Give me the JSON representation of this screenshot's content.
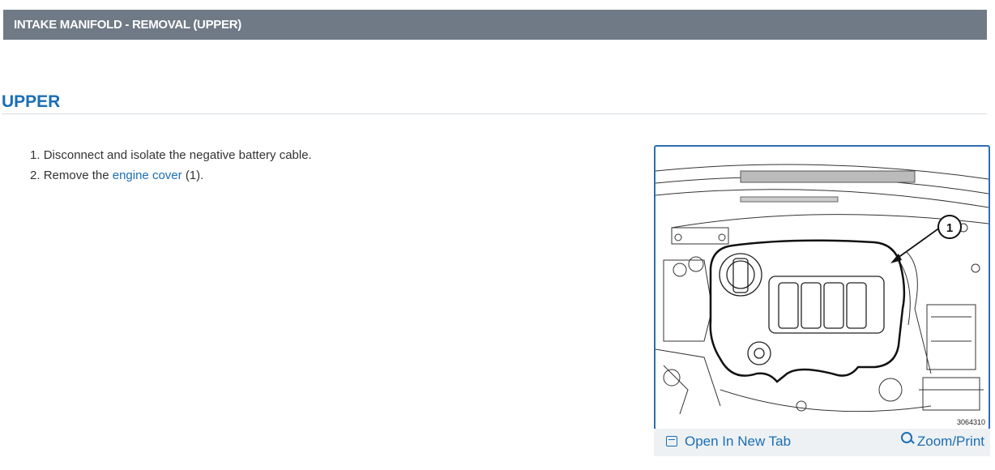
{
  "header": {
    "title": "INTAKE MANIFOLD - REMOVAL (UPPER)"
  },
  "section": {
    "title": "UPPER"
  },
  "steps": [
    {
      "number": "1.",
      "text": "Disconnect and isolate the negative battery cable."
    },
    {
      "number": "2.",
      "before": "Remove the",
      "link": "engine cover",
      "after": "(1)."
    }
  ],
  "figure": {
    "callout": "1",
    "id": "3064310",
    "open_tab_label": "Open In New Tab",
    "zoom_label": "Zoom/Print"
  },
  "colors": {
    "header_bg": "#6f7a86",
    "accent": "#1a6fb5",
    "frame": "#2e6db4"
  }
}
